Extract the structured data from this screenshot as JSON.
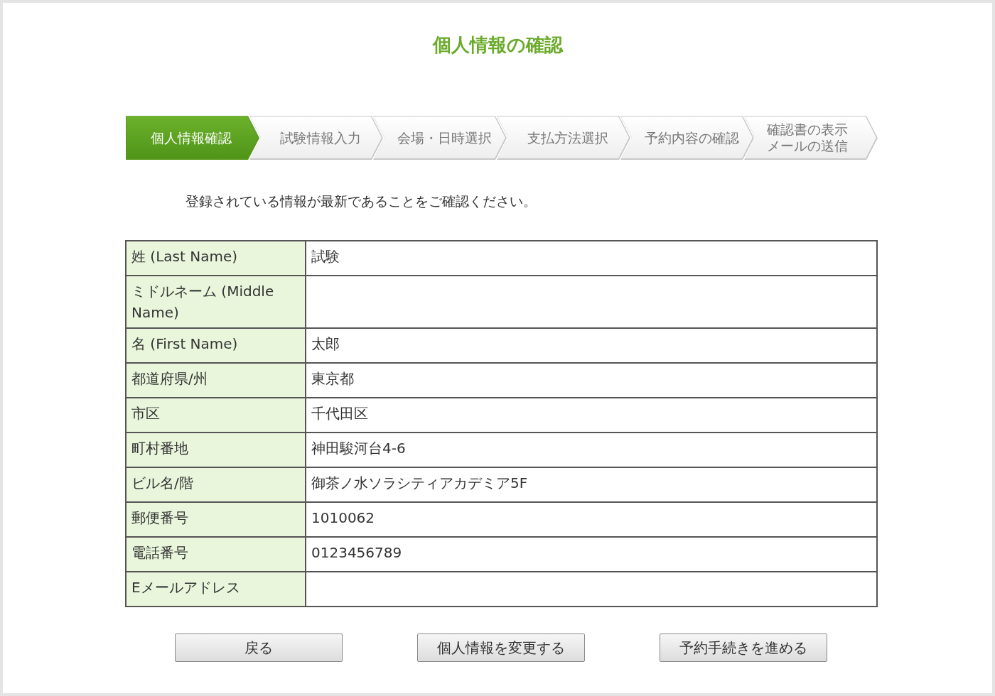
{
  "title": "個人情報の確認",
  "steps": [
    {
      "label": "個人情報確認",
      "selected": true
    },
    {
      "label": "試験情報入力",
      "selected": false
    },
    {
      "label": "会場・日時選択",
      "selected": false
    },
    {
      "label": "支払方法選択",
      "selected": false
    },
    {
      "label": "予約内容の確認",
      "selected": false
    },
    {
      "label": "確認書の表示メールの送信",
      "selected": false
    }
  ],
  "intro": "登録されている情報が最新であることをご確認ください。",
  "table": {
    "rows": [
      {
        "label": "姓 (Last Name)",
        "value": "試験"
      },
      {
        "label": "ミドルネーム (Middle Name)"
      },
      {
        "label": "名 (First Name)",
        "value": "太郎"
      },
      {
        "label": "都道府県/州",
        "value": "東京都"
      },
      {
        "label": "市区",
        "value": "千代田区"
      },
      {
        "label": "町村番地",
        "value": "神田駿河台4-6"
      },
      {
        "label": "ビル名/階",
        "value": "御茶ノ水ソラシティアカデミア5F"
      },
      {
        "label": "郵便番号",
        "value": "1010062"
      },
      {
        "label": "電話番号",
        "value": "0123456789"
      },
      {
        "label": "Eメールアドレス"
      }
    ]
  },
  "buttons": [
    "戻る",
    "個人情報を変更する",
    "予約手続きを進める"
  ]
}
